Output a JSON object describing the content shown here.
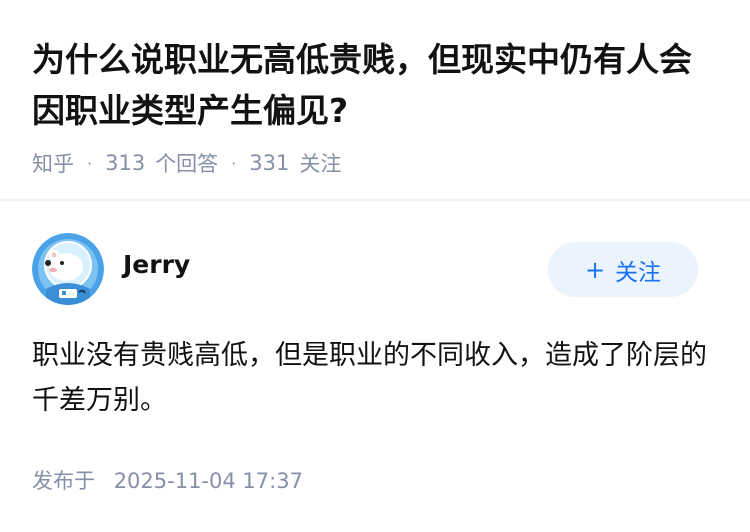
{
  "question": {
    "title": "为什么说职业无高低贵贱，但现实中仍有人会因职业类型产生偏见?",
    "source": "知乎",
    "answers_count": "313",
    "answers_label": "个回答",
    "followers_count": "331",
    "followers_label": "关注"
  },
  "answer": {
    "author_name": "Jerry",
    "avatar_icon": "polar-bear-astronaut-avatar",
    "follow_button": {
      "icon": "plus-icon",
      "icon_text": "+",
      "label": "关注"
    },
    "content": "职业没有贵贱高低，但是职业的不同收入，造成了阶层的千差万别。",
    "publish_label": "发布于",
    "publish_time": "2025-11-04 17:37"
  },
  "colors": {
    "title": "#121212",
    "meta": "#8590a6",
    "accent": "#1772f6",
    "follow_bg": "#ebf3fd",
    "avatar_bg": "#4aa3e6"
  }
}
